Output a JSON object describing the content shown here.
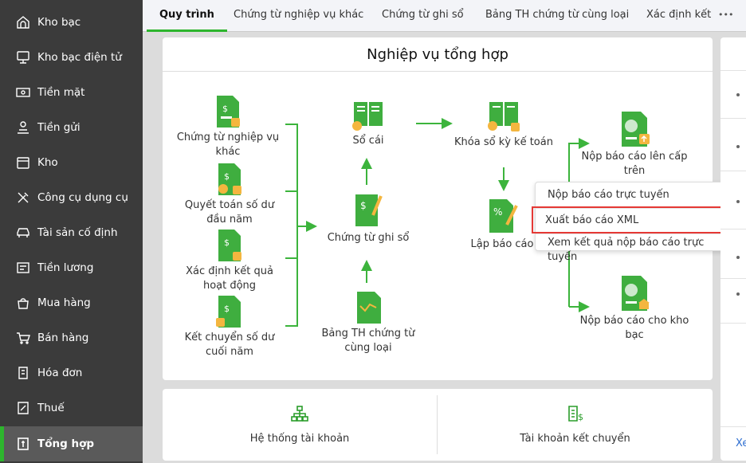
{
  "sidebar": {
    "items": [
      {
        "label": "Kho bạc",
        "icon": "bank-icon"
      },
      {
        "label": "Kho bạc điện tử",
        "icon": "monitor-icon"
      },
      {
        "label": "Tiền mặt",
        "icon": "cash-icon"
      },
      {
        "label": "Tiền gửi",
        "icon": "deposit-icon"
      },
      {
        "label": "Kho",
        "icon": "warehouse-icon"
      },
      {
        "label": "Công cụ dụng cụ",
        "icon": "tools-icon"
      },
      {
        "label": "Tài sản cố định",
        "icon": "car-icon"
      },
      {
        "label": "Tiền lương",
        "icon": "salary-icon"
      },
      {
        "label": "Mua hàng",
        "icon": "bag-icon"
      },
      {
        "label": "Bán hàng",
        "icon": "cart-icon"
      },
      {
        "label": "Hóa đơn",
        "icon": "invoice-icon"
      },
      {
        "label": "Thuế",
        "icon": "tax-icon"
      },
      {
        "label": "Tổng hợp",
        "icon": "summary-icon",
        "active": true
      }
    ]
  },
  "tabs": [
    "Quy trình",
    "Chứng từ nghiệp vụ khác",
    "Chứng từ ghi sổ",
    "Bảng TH chứng từ cùng loại",
    "Xác định kết"
  ],
  "more_label": "•••",
  "main": {
    "title": "Nghiệp vụ tổng hợp",
    "nodes": {
      "ct_nvk": "Chứng từ nghiệp vụ khác",
      "qt_sdn": "Quyết toán số dư đầu năm",
      "xd_kq": "Xác định kết quả hoạt động",
      "kc_scn": "Kết chuyển số dư cuối năm",
      "so_cai": "Sổ cái",
      "ct_gs": "Chứng từ ghi sổ",
      "bang_th": "Bảng TH chứng từ cùng loại",
      "khoa_so": "Khóa sổ kỳ kế toán",
      "lap_bc": "Lập báo cáo",
      "nop_ct": "Nộp báo cáo lên cấp trên",
      "nop_kb": "Nộp báo cáo cho kho bạc"
    }
  },
  "popup": {
    "items": [
      "Nộp báo cáo trực tuyến",
      "Xuất báo cáo XML",
      "Xem kết quả nộp báo cáo trực tuyến"
    ]
  },
  "bottom": {
    "left": "Hệ thống tài khoản",
    "right": "Tài khoản kết chuyển"
  },
  "right_panel": {
    "link": "Xe"
  },
  "colors": {
    "accent": "#2db52d",
    "highlight": "#e53935",
    "sidebar": "#3b3b3b"
  }
}
